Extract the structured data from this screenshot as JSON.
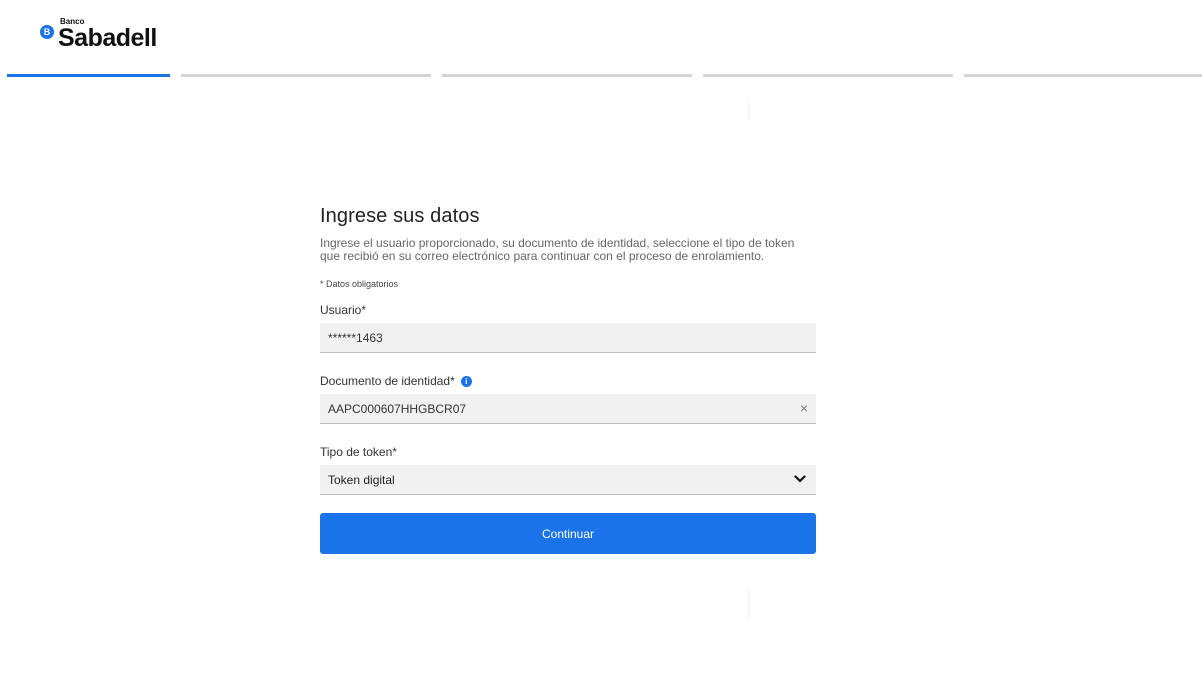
{
  "header": {
    "logo_badge": "B",
    "logo_small": "Banco",
    "logo_main": "Sabadell"
  },
  "stepper": {
    "total_steps": 5,
    "current_step": 1,
    "active_color": "#1a73e8",
    "inactive_color": "#d4d4d4"
  },
  "form": {
    "title": "Ingrese sus datos",
    "description": "Ingrese el usuario proporcionado, su documento de identidad, seleccione el tipo de token que recibió en su correo electrónico para continuar con el proceso de enrolamiento.",
    "required_note": "* Datos obligatorios",
    "usuario": {
      "label": "Usuario*",
      "value": "******1463"
    },
    "documento": {
      "label": "Documento de identidad*",
      "info_icon": "info-icon",
      "value": "AAPC000607HHGBCR07",
      "clear_icon": "close-icon"
    },
    "token": {
      "label": "Tipo de token*",
      "selected": "Token digital",
      "chevron_icon": "chevron-down-icon"
    },
    "continue_label": "Continuar"
  },
  "colors": {
    "accent": "#1a73e8",
    "field_bg": "#f1f1f1"
  }
}
